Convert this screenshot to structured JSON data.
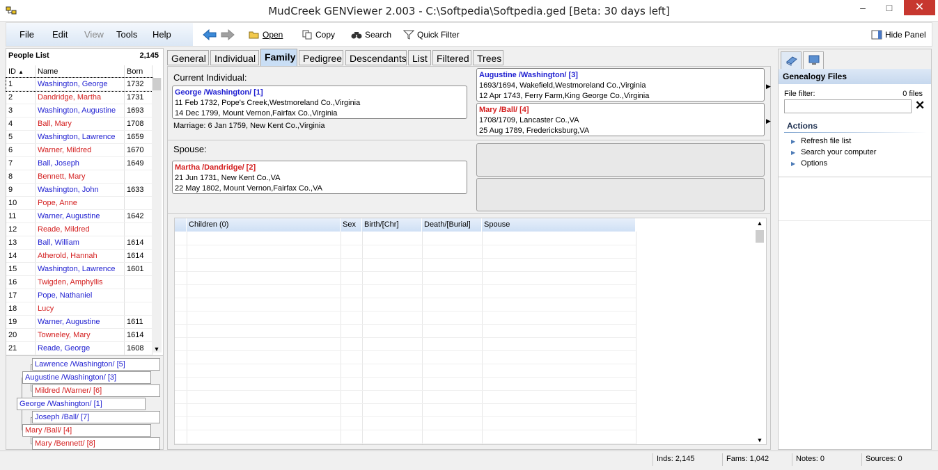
{
  "window": {
    "title": "MudCreek GENViewer 2.003 - C:\\Softpedia\\Softpedia.ged [Beta: 30 days left]",
    "minimize": "–",
    "maximize": "□",
    "close": "✕"
  },
  "menu": {
    "file": "File",
    "edit": "Edit",
    "view": "View",
    "tools": "Tools",
    "help": "Help"
  },
  "toolbar": {
    "open": "Open",
    "copy": "Copy",
    "search": "Search",
    "quick_filter": "Quick Filter",
    "hide_panel": "Hide Panel"
  },
  "people_list": {
    "title": "People List",
    "count": "2,145",
    "headers": {
      "id": "ID",
      "name": "Name",
      "born": "Born"
    },
    "rows": [
      {
        "id": "1",
        "name": "Washington, George",
        "born": "1732",
        "sex": "male"
      },
      {
        "id": "2",
        "name": "Dandridge, Martha",
        "born": "1731",
        "sex": "female"
      },
      {
        "id": "3",
        "name": "Washington, Augustine",
        "born": "1693",
        "sex": "male"
      },
      {
        "id": "4",
        "name": "Ball, Mary",
        "born": "1708",
        "sex": "female"
      },
      {
        "id": "5",
        "name": "Washington, Lawrence",
        "born": "1659",
        "sex": "male"
      },
      {
        "id": "6",
        "name": "Warner, Mildred",
        "born": "1670",
        "sex": "female"
      },
      {
        "id": "7",
        "name": "Ball, Joseph",
        "born": "1649",
        "sex": "male"
      },
      {
        "id": "8",
        "name": "Bennett, Mary",
        "born": "",
        "sex": "female"
      },
      {
        "id": "9",
        "name": "Washington, John",
        "born": "1633",
        "sex": "male"
      },
      {
        "id": "10",
        "name": "Pope, Anne",
        "born": "",
        "sex": "female"
      },
      {
        "id": "11",
        "name": "Warner, Augustine",
        "born": "1642",
        "sex": "male"
      },
      {
        "id": "12",
        "name": "Reade, Mildred",
        "born": "",
        "sex": "female"
      },
      {
        "id": "13",
        "name": "Ball, William",
        "born": "1614",
        "sex": "male"
      },
      {
        "id": "14",
        "name": "Atherold, Hannah",
        "born": "1614",
        "sex": "female"
      },
      {
        "id": "15",
        "name": "Washington, Lawrence",
        "born": "1601",
        "sex": "male"
      },
      {
        "id": "16",
        "name": "Twigden, Amphyllis",
        "born": "",
        "sex": "female"
      },
      {
        "id": "17",
        "name": "Pope, Nathaniel",
        "born": "",
        "sex": "male"
      },
      {
        "id": "18",
        "name": "Lucy",
        "born": "",
        "sex": "female"
      },
      {
        "id": "19",
        "name": "Warner, Augustine",
        "born": "1611",
        "sex": "male"
      },
      {
        "id": "20",
        "name": "Towneley, Mary",
        "born": "1614",
        "sex": "female"
      },
      {
        "id": "21",
        "name": "Reade, George",
        "born": "1608",
        "sex": "male"
      }
    ]
  },
  "mini_tree": {
    "lawrence": "Lawrence /Washington/ [5]",
    "augustine": "Augustine /Washington/ [3]",
    "mildred": "Mildred /Warner/ [6]",
    "george": "George /Washington/ [1]",
    "joseph": "Joseph /Ball/ [7]",
    "mary_ball": "Mary /Ball/ [4]",
    "mary_bennett": "Mary /Bennett/ [8]"
  },
  "tabs": [
    "General",
    "Individual",
    "Family",
    "Pedigree",
    "Descendants",
    "List",
    "Filtered",
    "Trees"
  ],
  "active_tab": "Family",
  "family": {
    "current_label": "Current Individual:",
    "current": {
      "name": "George /Washington/ [1]",
      "birth": "11 Feb 1732, Pope's Creek,Westmoreland Co.,Virginia",
      "death": "14 Dec 1799, Mount Vernon,Fairfax Co.,Virginia"
    },
    "marriage": "Marriage: 6 Jan 1759, New Kent Co.,Virginia",
    "father": {
      "name": "Augustine /Washington/ [3]",
      "birth": "1693/1694, Wakefield,Westmoreland Co.,Virginia",
      "death": "12 Apr 1743, Ferry Farm,King George Co.,Virginia"
    },
    "mother": {
      "name": "Mary /Ball/ [4]",
      "birth": "1708/1709, Lancaster Co.,VA",
      "death": "25 Aug 1789, Fredericksburg,VA"
    },
    "spouse_label": "Spouse:",
    "spouse": {
      "name": "Martha /Dandridge/ [2]",
      "birth": "21 Jun 1731, New Kent Co.,VA",
      "death": "22 May 1802, Mount Vernon,Fairfax Co.,VA"
    },
    "children_headers": {
      "children": "Children (0)",
      "sex": "Sex",
      "birth": "Birth/[Chr]",
      "death": "Death/[Burial]",
      "spouse": "Spouse"
    }
  },
  "right_panel": {
    "header": "Genealogy Files",
    "file_filter_label": "File filter:",
    "file_count": "0 files",
    "actions_title": "Actions",
    "actions": [
      "Refresh file list",
      "Search your computer",
      "Options"
    ]
  },
  "status": {
    "inds": "Inds: 2,145",
    "fams": "Fams: 1,042",
    "notes": "Notes: 0",
    "sources": "Sources: 0"
  },
  "colors": {
    "male": "#1f1fd1",
    "female": "#d42020",
    "accent": "#c9def5"
  }
}
